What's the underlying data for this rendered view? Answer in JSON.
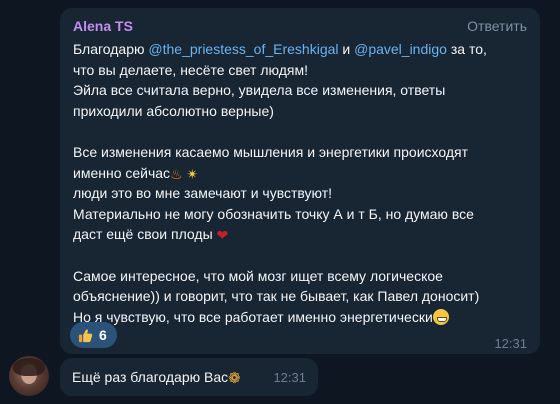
{
  "message": {
    "sender": "Alena TS",
    "reply_label": "Ответить",
    "line1_prefix": "Благодарю ",
    "mention1": "@the_priestess_of_Ereshkigal",
    "line1_mid": " и ",
    "mention2": "@pavel_indigo",
    "line1_suffix": " за то,",
    "line2": "что вы делаете, несёте свет людям!",
    "line3": "Эйла все считала верно, увидела все изменения, ответы",
    "line4": "приходили абсолютно верные)",
    "line5": "Все изменения касаемо мышления и энергетики происходят",
    "line6": "именно сейчас",
    "line7": "люди это во мне замечают и чувствуют!",
    "line8": "Материально не могу обозначить точку А и т Б, но думаю все",
    "line9": "даст ещё свои плоды",
    "line10": "Самое интересное, что мой мозг   ищет всему логическое",
    "line11": "объяснение)) и говорит, что так не бывает, как Павел доносит)",
    "line12": "Но я чувствую, что все работает именно энергетически",
    "reaction_count": "6",
    "time": "12:31"
  },
  "second_message": {
    "text": "Ещё раз благодарю Вас",
    "time": "12:31"
  },
  "icons": {
    "fire": "fire-emoji",
    "dizzy": "dizzy-emoji",
    "heart": "heart-emoji",
    "grin": "grinning-emoji",
    "thumbs": "thumbs-up-emoji",
    "pray": "praying-hands-emoji"
  },
  "colors": {
    "background": "#0e1621",
    "bubble": "#182533",
    "sender": "#c38ef0",
    "mention": "#6ab3f3",
    "reaction_bg": "#2b5278",
    "meta": "#6d7f8f"
  }
}
